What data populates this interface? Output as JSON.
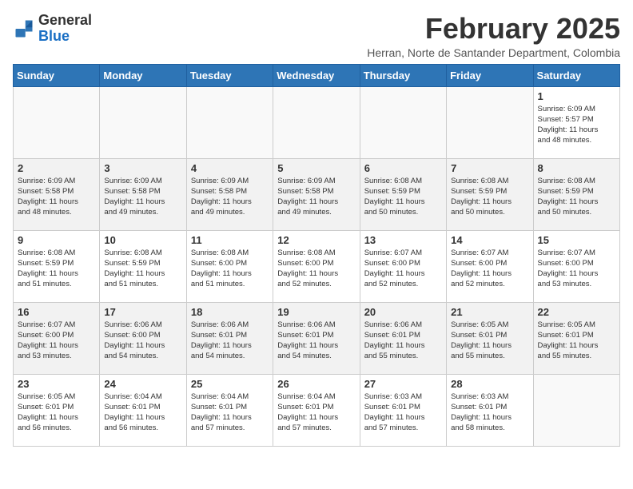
{
  "header": {
    "logo_general": "General",
    "logo_blue": "Blue",
    "month_year": "February 2025",
    "location": "Herran, Norte de Santander Department, Colombia"
  },
  "weekdays": [
    "Sunday",
    "Monday",
    "Tuesday",
    "Wednesday",
    "Thursday",
    "Friday",
    "Saturday"
  ],
  "weeks": [
    [
      {
        "day": "",
        "info": ""
      },
      {
        "day": "",
        "info": ""
      },
      {
        "day": "",
        "info": ""
      },
      {
        "day": "",
        "info": ""
      },
      {
        "day": "",
        "info": ""
      },
      {
        "day": "",
        "info": ""
      },
      {
        "day": "1",
        "info": "Sunrise: 6:09 AM\nSunset: 5:57 PM\nDaylight: 11 hours\nand 48 minutes."
      }
    ],
    [
      {
        "day": "2",
        "info": "Sunrise: 6:09 AM\nSunset: 5:58 PM\nDaylight: 11 hours\nand 48 minutes."
      },
      {
        "day": "3",
        "info": "Sunrise: 6:09 AM\nSunset: 5:58 PM\nDaylight: 11 hours\nand 49 minutes."
      },
      {
        "day": "4",
        "info": "Sunrise: 6:09 AM\nSunset: 5:58 PM\nDaylight: 11 hours\nand 49 minutes."
      },
      {
        "day": "5",
        "info": "Sunrise: 6:09 AM\nSunset: 5:58 PM\nDaylight: 11 hours\nand 49 minutes."
      },
      {
        "day": "6",
        "info": "Sunrise: 6:08 AM\nSunset: 5:59 PM\nDaylight: 11 hours\nand 50 minutes."
      },
      {
        "day": "7",
        "info": "Sunrise: 6:08 AM\nSunset: 5:59 PM\nDaylight: 11 hours\nand 50 minutes."
      },
      {
        "day": "8",
        "info": "Sunrise: 6:08 AM\nSunset: 5:59 PM\nDaylight: 11 hours\nand 50 minutes."
      }
    ],
    [
      {
        "day": "9",
        "info": "Sunrise: 6:08 AM\nSunset: 5:59 PM\nDaylight: 11 hours\nand 51 minutes."
      },
      {
        "day": "10",
        "info": "Sunrise: 6:08 AM\nSunset: 5:59 PM\nDaylight: 11 hours\nand 51 minutes."
      },
      {
        "day": "11",
        "info": "Sunrise: 6:08 AM\nSunset: 6:00 PM\nDaylight: 11 hours\nand 51 minutes."
      },
      {
        "day": "12",
        "info": "Sunrise: 6:08 AM\nSunset: 6:00 PM\nDaylight: 11 hours\nand 52 minutes."
      },
      {
        "day": "13",
        "info": "Sunrise: 6:07 AM\nSunset: 6:00 PM\nDaylight: 11 hours\nand 52 minutes."
      },
      {
        "day": "14",
        "info": "Sunrise: 6:07 AM\nSunset: 6:00 PM\nDaylight: 11 hours\nand 52 minutes."
      },
      {
        "day": "15",
        "info": "Sunrise: 6:07 AM\nSunset: 6:00 PM\nDaylight: 11 hours\nand 53 minutes."
      }
    ],
    [
      {
        "day": "16",
        "info": "Sunrise: 6:07 AM\nSunset: 6:00 PM\nDaylight: 11 hours\nand 53 minutes."
      },
      {
        "day": "17",
        "info": "Sunrise: 6:06 AM\nSunset: 6:00 PM\nDaylight: 11 hours\nand 54 minutes."
      },
      {
        "day": "18",
        "info": "Sunrise: 6:06 AM\nSunset: 6:01 PM\nDaylight: 11 hours\nand 54 minutes."
      },
      {
        "day": "19",
        "info": "Sunrise: 6:06 AM\nSunset: 6:01 PM\nDaylight: 11 hours\nand 54 minutes."
      },
      {
        "day": "20",
        "info": "Sunrise: 6:06 AM\nSunset: 6:01 PM\nDaylight: 11 hours\nand 55 minutes."
      },
      {
        "day": "21",
        "info": "Sunrise: 6:05 AM\nSunset: 6:01 PM\nDaylight: 11 hours\nand 55 minutes."
      },
      {
        "day": "22",
        "info": "Sunrise: 6:05 AM\nSunset: 6:01 PM\nDaylight: 11 hours\nand 55 minutes."
      }
    ],
    [
      {
        "day": "23",
        "info": "Sunrise: 6:05 AM\nSunset: 6:01 PM\nDaylight: 11 hours\nand 56 minutes."
      },
      {
        "day": "24",
        "info": "Sunrise: 6:04 AM\nSunset: 6:01 PM\nDaylight: 11 hours\nand 56 minutes."
      },
      {
        "day": "25",
        "info": "Sunrise: 6:04 AM\nSunset: 6:01 PM\nDaylight: 11 hours\nand 57 minutes."
      },
      {
        "day": "26",
        "info": "Sunrise: 6:04 AM\nSunset: 6:01 PM\nDaylight: 11 hours\nand 57 minutes."
      },
      {
        "day": "27",
        "info": "Sunrise: 6:03 AM\nSunset: 6:01 PM\nDaylight: 11 hours\nand 57 minutes."
      },
      {
        "day": "28",
        "info": "Sunrise: 6:03 AM\nSunset: 6:01 PM\nDaylight: 11 hours\nand 58 minutes."
      },
      {
        "day": "",
        "info": ""
      }
    ]
  ]
}
